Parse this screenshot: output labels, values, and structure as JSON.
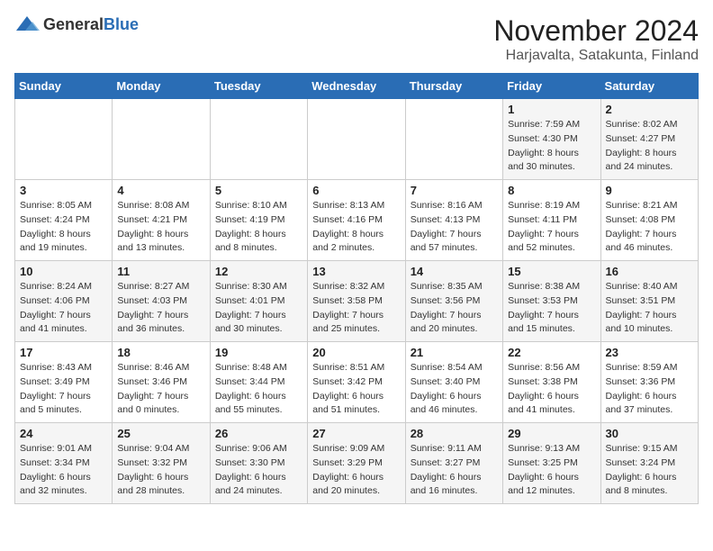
{
  "logo": {
    "text_general": "General",
    "text_blue": "Blue"
  },
  "title": {
    "month": "November 2024",
    "location": "Harjavalta, Satakunta, Finland"
  },
  "headers": [
    "Sunday",
    "Monday",
    "Tuesday",
    "Wednesday",
    "Thursday",
    "Friday",
    "Saturday"
  ],
  "weeks": [
    [
      {
        "day": "",
        "sunrise": "",
        "sunset": "",
        "daylight": ""
      },
      {
        "day": "",
        "sunrise": "",
        "sunset": "",
        "daylight": ""
      },
      {
        "day": "",
        "sunrise": "",
        "sunset": "",
        "daylight": ""
      },
      {
        "day": "",
        "sunrise": "",
        "sunset": "",
        "daylight": ""
      },
      {
        "day": "",
        "sunrise": "",
        "sunset": "",
        "daylight": ""
      },
      {
        "day": "1",
        "sunrise": "Sunrise: 7:59 AM",
        "sunset": "Sunset: 4:30 PM",
        "daylight": "Daylight: 8 hours and 30 minutes."
      },
      {
        "day": "2",
        "sunrise": "Sunrise: 8:02 AM",
        "sunset": "Sunset: 4:27 PM",
        "daylight": "Daylight: 8 hours and 24 minutes."
      }
    ],
    [
      {
        "day": "3",
        "sunrise": "Sunrise: 8:05 AM",
        "sunset": "Sunset: 4:24 PM",
        "daylight": "Daylight: 8 hours and 19 minutes."
      },
      {
        "day": "4",
        "sunrise": "Sunrise: 8:08 AM",
        "sunset": "Sunset: 4:21 PM",
        "daylight": "Daylight: 8 hours and 13 minutes."
      },
      {
        "day": "5",
        "sunrise": "Sunrise: 8:10 AM",
        "sunset": "Sunset: 4:19 PM",
        "daylight": "Daylight: 8 hours and 8 minutes."
      },
      {
        "day": "6",
        "sunrise": "Sunrise: 8:13 AM",
        "sunset": "Sunset: 4:16 PM",
        "daylight": "Daylight: 8 hours and 2 minutes."
      },
      {
        "day": "7",
        "sunrise": "Sunrise: 8:16 AM",
        "sunset": "Sunset: 4:13 PM",
        "daylight": "Daylight: 7 hours and 57 minutes."
      },
      {
        "day": "8",
        "sunrise": "Sunrise: 8:19 AM",
        "sunset": "Sunset: 4:11 PM",
        "daylight": "Daylight: 7 hours and 52 minutes."
      },
      {
        "day": "9",
        "sunrise": "Sunrise: 8:21 AM",
        "sunset": "Sunset: 4:08 PM",
        "daylight": "Daylight: 7 hours and 46 minutes."
      }
    ],
    [
      {
        "day": "10",
        "sunrise": "Sunrise: 8:24 AM",
        "sunset": "Sunset: 4:06 PM",
        "daylight": "Daylight: 7 hours and 41 minutes."
      },
      {
        "day": "11",
        "sunrise": "Sunrise: 8:27 AM",
        "sunset": "Sunset: 4:03 PM",
        "daylight": "Daylight: 7 hours and 36 minutes."
      },
      {
        "day": "12",
        "sunrise": "Sunrise: 8:30 AM",
        "sunset": "Sunset: 4:01 PM",
        "daylight": "Daylight: 7 hours and 30 minutes."
      },
      {
        "day": "13",
        "sunrise": "Sunrise: 8:32 AM",
        "sunset": "Sunset: 3:58 PM",
        "daylight": "Daylight: 7 hours and 25 minutes."
      },
      {
        "day": "14",
        "sunrise": "Sunrise: 8:35 AM",
        "sunset": "Sunset: 3:56 PM",
        "daylight": "Daylight: 7 hours and 20 minutes."
      },
      {
        "day": "15",
        "sunrise": "Sunrise: 8:38 AM",
        "sunset": "Sunset: 3:53 PM",
        "daylight": "Daylight: 7 hours and 15 minutes."
      },
      {
        "day": "16",
        "sunrise": "Sunrise: 8:40 AM",
        "sunset": "Sunset: 3:51 PM",
        "daylight": "Daylight: 7 hours and 10 minutes."
      }
    ],
    [
      {
        "day": "17",
        "sunrise": "Sunrise: 8:43 AM",
        "sunset": "Sunset: 3:49 PM",
        "daylight": "Daylight: 7 hours and 5 minutes."
      },
      {
        "day": "18",
        "sunrise": "Sunrise: 8:46 AM",
        "sunset": "Sunset: 3:46 PM",
        "daylight": "Daylight: 7 hours and 0 minutes."
      },
      {
        "day": "19",
        "sunrise": "Sunrise: 8:48 AM",
        "sunset": "Sunset: 3:44 PM",
        "daylight": "Daylight: 6 hours and 55 minutes."
      },
      {
        "day": "20",
        "sunrise": "Sunrise: 8:51 AM",
        "sunset": "Sunset: 3:42 PM",
        "daylight": "Daylight: 6 hours and 51 minutes."
      },
      {
        "day": "21",
        "sunrise": "Sunrise: 8:54 AM",
        "sunset": "Sunset: 3:40 PM",
        "daylight": "Daylight: 6 hours and 46 minutes."
      },
      {
        "day": "22",
        "sunrise": "Sunrise: 8:56 AM",
        "sunset": "Sunset: 3:38 PM",
        "daylight": "Daylight: 6 hours and 41 minutes."
      },
      {
        "day": "23",
        "sunrise": "Sunrise: 8:59 AM",
        "sunset": "Sunset: 3:36 PM",
        "daylight": "Daylight: 6 hours and 37 minutes."
      }
    ],
    [
      {
        "day": "24",
        "sunrise": "Sunrise: 9:01 AM",
        "sunset": "Sunset: 3:34 PM",
        "daylight": "Daylight: 6 hours and 32 minutes."
      },
      {
        "day": "25",
        "sunrise": "Sunrise: 9:04 AM",
        "sunset": "Sunset: 3:32 PM",
        "daylight": "Daylight: 6 hours and 28 minutes."
      },
      {
        "day": "26",
        "sunrise": "Sunrise: 9:06 AM",
        "sunset": "Sunset: 3:30 PM",
        "daylight": "Daylight: 6 hours and 24 minutes."
      },
      {
        "day": "27",
        "sunrise": "Sunrise: 9:09 AM",
        "sunset": "Sunset: 3:29 PM",
        "daylight": "Daylight: 6 hours and 20 minutes."
      },
      {
        "day": "28",
        "sunrise": "Sunrise: 9:11 AM",
        "sunset": "Sunset: 3:27 PM",
        "daylight": "Daylight: 6 hours and 16 minutes."
      },
      {
        "day": "29",
        "sunrise": "Sunrise: 9:13 AM",
        "sunset": "Sunset: 3:25 PM",
        "daylight": "Daylight: 6 hours and 12 minutes."
      },
      {
        "day": "30",
        "sunrise": "Sunrise: 9:15 AM",
        "sunset": "Sunset: 3:24 PM",
        "daylight": "Daylight: 6 hours and 8 minutes."
      }
    ]
  ]
}
